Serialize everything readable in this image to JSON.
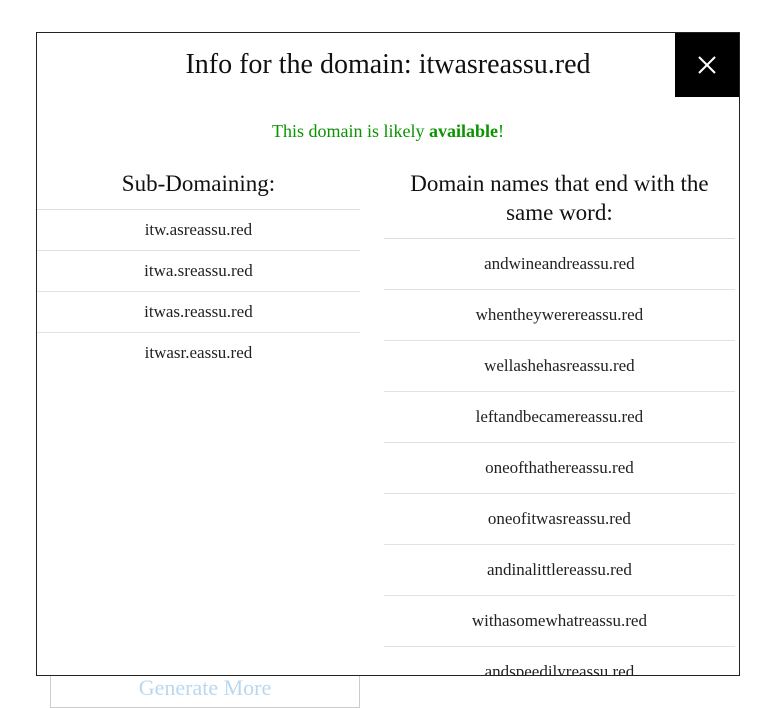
{
  "backdrop": {
    "generate_more_label": "Generate More"
  },
  "modal": {
    "title": "Info for the domain: itwasreassu.red",
    "close_icon": "close",
    "availability": {
      "prefix": "This domain is likely ",
      "word": "available",
      "suffix": "!"
    },
    "left": {
      "header": "Sub-Domaining:",
      "items": [
        "itw.asreassu.red",
        "itwa.sreassu.red",
        "itwas.reassu.red",
        "itwasr.eassu.red"
      ]
    },
    "right": {
      "header": "Domain names that end with the same word:",
      "items": [
        "andwineandreassu.red",
        "whentheywerereassu.red",
        "wellashehasreassu.red",
        "leftandbecamereassu.red",
        "oneofthathereassu.red",
        "oneofitwasreassu.red",
        "andinalittlereassu.red",
        "withasomewhatreassu.red",
        "andspeedilyreassu.red"
      ]
    }
  }
}
